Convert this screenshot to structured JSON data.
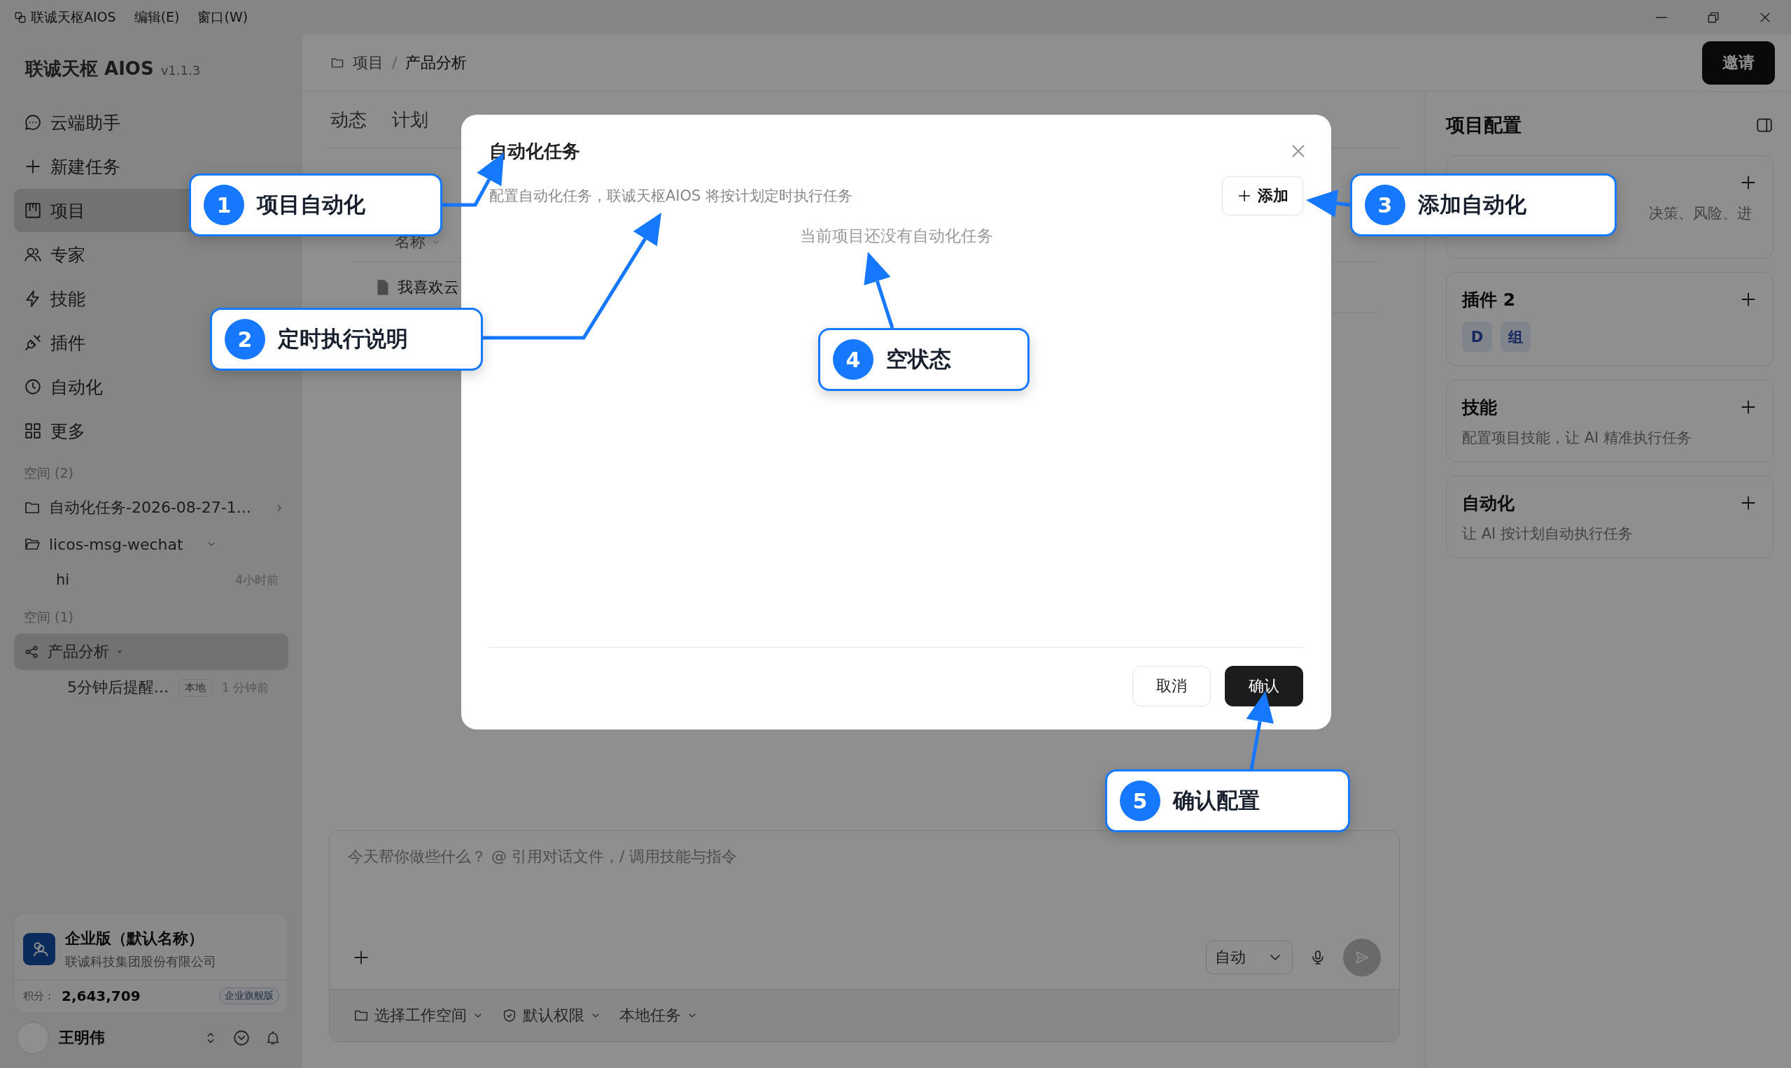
{
  "titlebar": {
    "menus": [
      "联诚天枢AIOS",
      "编辑(E)",
      "窗口(W)"
    ]
  },
  "sidebar": {
    "brand": "联诚天枢 AIOS",
    "version": "v1.1.3",
    "nav": [
      {
        "label": "云端助手",
        "selected": false
      },
      {
        "label": "新建任务",
        "selected": false
      },
      {
        "label": "项目",
        "selected": true
      },
      {
        "label": "专家",
        "selected": false
      },
      {
        "label": "技能",
        "selected": false
      },
      {
        "label": "插件",
        "selected": false
      },
      {
        "label": "自动化",
        "selected": false
      },
      {
        "label": "更多",
        "selected": false
      }
    ],
    "spaces": [
      {
        "heading": "空间 (2)",
        "items": [
          {
            "kind": "folder",
            "name": "自动化任务-2026-08-27-1...",
            "expanded": false,
            "selected": false
          },
          {
            "kind": "folder",
            "name": "licos-msg-wechat",
            "expanded": true,
            "selected": false,
            "children": [
              {
                "title": "hi",
                "time": "4小时前"
              }
            ]
          }
        ]
      },
      {
        "heading": "空间 (1)",
        "items": [
          {
            "kind": "project",
            "name": "产品分析",
            "expanded": true,
            "selected": true,
            "children": [
              {
                "title": "5分钟后提醒...",
                "tag": "本地",
                "time": "1 分钟前"
              }
            ]
          }
        ]
      }
    ],
    "account": {
      "plan": "企业版（默认名称）",
      "company": "联诚科技集团股份有限公司",
      "points_label": "积分：",
      "points": "2,643,709",
      "badge": "企业旗舰版"
    },
    "user": {
      "name": "王明伟"
    }
  },
  "header": {
    "breadcrumb": [
      "项目",
      "产品分析"
    ],
    "separator": "/",
    "invite": "邀请"
  },
  "tabs": [
    {
      "label": "动态",
      "selected": false
    },
    {
      "label": "计划",
      "selected": false
    }
  ],
  "files": {
    "column": "名称",
    "rows": [
      "我喜欢云"
    ]
  },
  "right_panel": {
    "title": "项目配置",
    "cards": [
      {
        "kind": "text",
        "description": "决策、风险、进"
      },
      {
        "kind": "chips",
        "title": "插件 2",
        "chips": [
          "D",
          "组"
        ]
      },
      {
        "kind": "text",
        "title": "技能",
        "description": "配置项目技能，让 AI 精准执行任务"
      },
      {
        "kind": "text",
        "title": "自动化",
        "description": "让 AI 按计划自动执行任务"
      }
    ]
  },
  "composer": {
    "placeholder": "今天帮你做些什么？ @ 引用对话文件，/ 调用技能与指令",
    "mode": "自动",
    "options": [
      "选择工作空间",
      "默认权限",
      "本地任务"
    ]
  },
  "dialog": {
    "title": "自动化任务",
    "description": "配置自动化任务，联诚天枢AIOS 将按计划定时执行任务",
    "add": "添加",
    "empty": "当前项目还没有自动化任务",
    "cancel": "取消",
    "confirm": "确认"
  },
  "callouts": [
    {
      "number": "1",
      "label": "项目自动化"
    },
    {
      "number": "2",
      "label": "定时执行说明"
    },
    {
      "number": "3",
      "label": "添加自动化"
    },
    {
      "number": "4",
      "label": "空状态"
    },
    {
      "number": "5",
      "label": "确认配置"
    }
  ]
}
